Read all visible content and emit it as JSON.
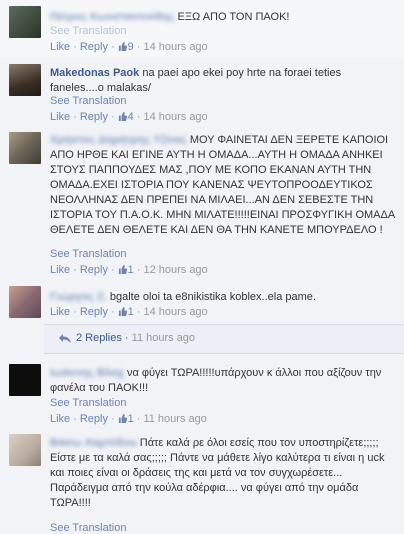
{
  "see_translation": "See Translation",
  "like": "Like",
  "reply": "Reply",
  "comments": [
    {
      "author": "Πέτρος Κωνσταντινίδης",
      "author_blurred": true,
      "text": "ΕΞΩ ΑΠΟ ΤΟΝ ΠΑΟΚ!",
      "likes": "9",
      "time": "14 hours ago"
    },
    {
      "author": "Makedonas Paok",
      "author_blurred": false,
      "text": "na paei apo ekei poy hrte na foraei teties faneles....o malakas/",
      "likes": "4",
      "time": "14 hours ago"
    },
    {
      "author": "Χρήστος Δημήτρης Τζίνας",
      "author_blurred": true,
      "text": "ΜΟΥ ΦΑΙΝΕΤΑΙ ΔΕΝ ΞΕΡΕΤΕ ΚΑΠΟΙΟΙ ΑΠΟ ΗΡΘΕ ΚΑΙ ΕΓΙΝΕ ΑΥΤΗ Η ΟΜΑΔΑ...ΑΥΤΗ Η ΟΜΑΔΑ ΑΝΗΚΕΙ ΣΤΟΥΣ ΠΑΠΠΟΥΔΕΣ ΜΑΣ ,ΠΟΥ ΜΕ ΚΟΠΟ ΕΚΑΝΑΝ ΑΥΤΗ ΤΗΝ ΟΜΑΔΑ.ΕΧΕΙ ΙΣΤΟΡΙΑ ΠΟΥ ΚΑΝΕΝΑΣ ΨΕΥΤΟΠΡΟΟΔΕΥΤΙΚΟΣ ΝΕΟΛΛΗΝΑΣ ΔΕΝ ΠΡΕΠΕΙ ΝΑ ΜΙΛΑΕΙ...ΑΝ ΔΕΝ ΣΕΒΕΣΤΕ ΤΗΝ ΙΣΤΟΡΙΑ ΤΟΥ Π.Α.Ο.Κ. ΜΗΝ ΜΙΛΑΤΕ!!!!!ΕΙΝΑΙ ΠΡΟΣΦΥΓΙΚΗ ΟΜΑΔΑ ΘΕΛΕΤΕ ΔΕΝ ΘΕΛΕΤΕ ΚΑΙ ΔΕΝ ΘΑ ΤΗΝ ΚΑΝΕΤΕ ΜΠΟΥΡΔΕΛΟ !",
      "likes": "1",
      "time": "12 hours ago"
    },
    {
      "author": "Γιώργος Ζ.",
      "author_blurred": true,
      "text": "bgalte oloi ta e8nikistika koblex..ela pame.",
      "likes": "1",
      "time": "14 hours ago",
      "replies_label": "2 Replies",
      "replies_time": "11 hours ago"
    },
    {
      "author": "Ιωάννης Βλαχ",
      "author_blurred": true,
      "text": "να φύγει ΤΩΡΑ!!!!!υπάρχουν κ άλλοι που αξίζουν την φανέλα του ΠΑΟΚ!!!",
      "likes": "1",
      "time": "11 hours ago"
    },
    {
      "author": "Βάσω Χαμπίδου",
      "author_blurred": true,
      "text": "Πάτε καλά ρε όλοι εσείς που τον υποστηρίζετε;;;;; Είστε με τα καλά σας;;;;; Πάντε να μάθετε λίγο καλύτερα τι είναι η uck και ποιες είναι οι δράσεις της και μετά να τον συγχωρέσετε... Παράδειγμα από την κούλα αδέρφια.... να φύγει από την ομάδα ΤΩΡΑ!!!!",
      "likes": "",
      "time": ""
    }
  ]
}
